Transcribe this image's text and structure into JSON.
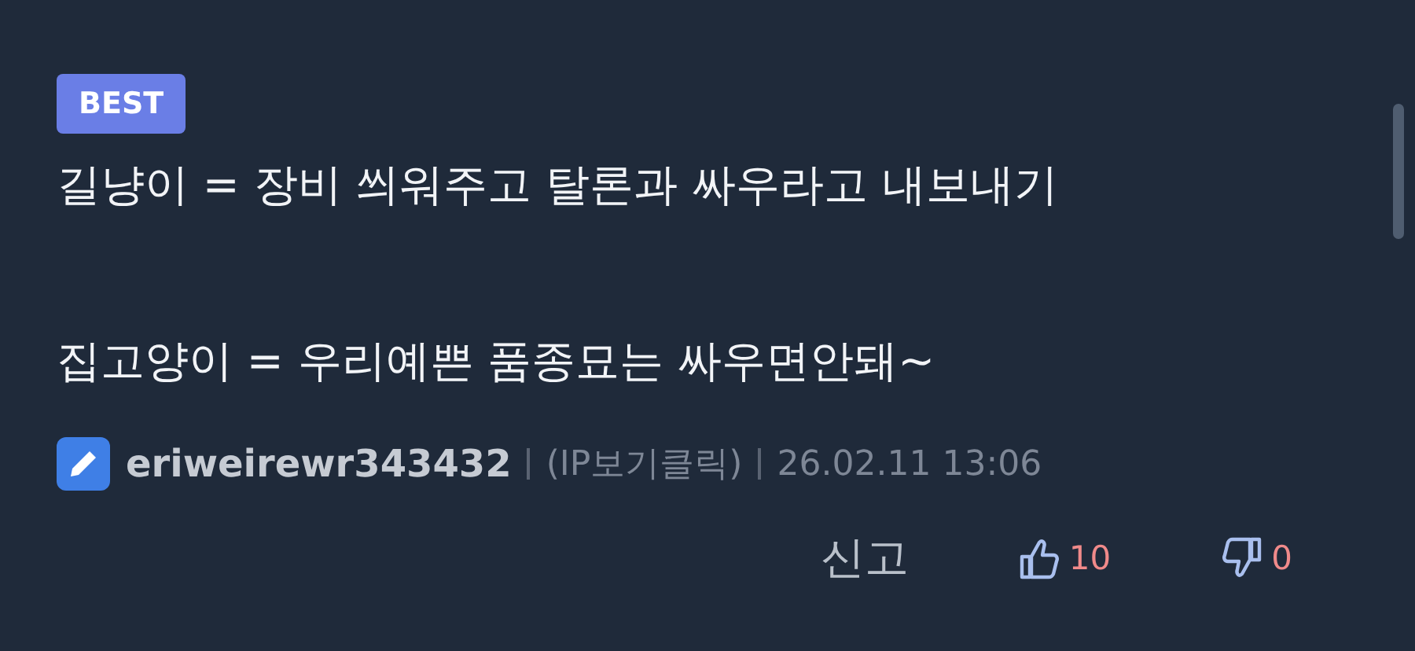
{
  "badge": "BEST",
  "lines": [
    "길냥이 = 장비 씌워주고 탈론과 싸우라고 내보내기",
    "집고양이 = 우리예쁜 품종묘는 싸우면안돼~"
  ],
  "meta": {
    "author": "eriweirewr343432",
    "ip": "(IP보기클릭)",
    "date": "26.02.11 13:06"
  },
  "actions": {
    "report": "신고",
    "likes": "10",
    "dislikes": "0"
  }
}
